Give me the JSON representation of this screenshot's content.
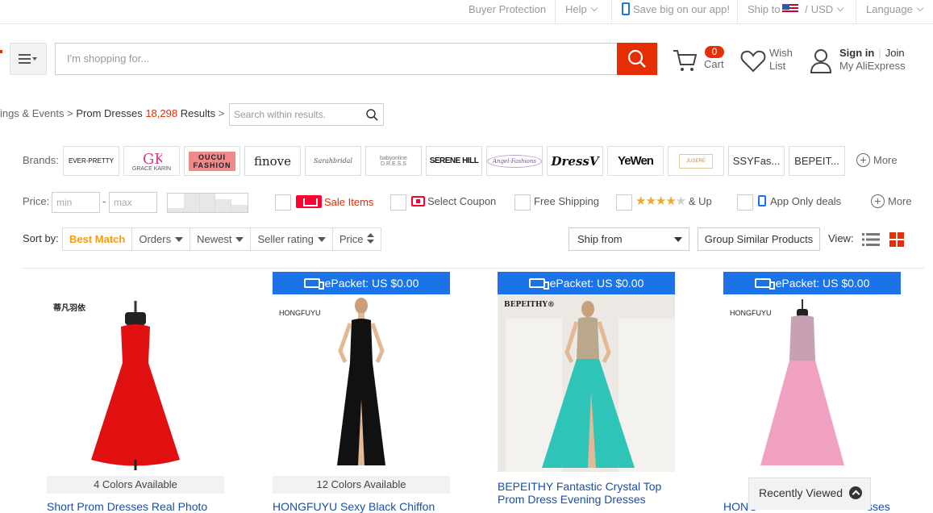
{
  "topbar": {
    "buyer_protection": "Buyer Protection",
    "help": "Help",
    "app": "Save big on our app!",
    "ship_to": "Ship to",
    "currency_sep": "/",
    "currency": "USD",
    "language": "Language"
  },
  "header": {
    "search_placeholder": "I'm shopping for...",
    "cart_count": "0",
    "cart_label": "Cart",
    "wish_line1": "Wish",
    "wish_line2": "List",
    "sign_in": "Sign in",
    "join": "Join",
    "my_account": "My AliExpress"
  },
  "breadcrumb": {
    "parent": "ings & Events",
    "sep": ">",
    "current": "Prom Dresses",
    "count": "18,298",
    "results_label": "Results",
    "sep2": ">",
    "within_placeholder": "Search within results."
  },
  "brands": {
    "label": "Brands:",
    "items": [
      "EVER-PRETTY",
      "GRACE KARIN",
      "OUCUI FASHION",
      "finove",
      "Sarahbridal",
      "babyonline D.R.E.S.S",
      "SERENE HILL",
      "Angel-Fashions",
      "DressV",
      "YeWen",
      "JUSERE",
      "SSYFas...",
      "BEPEIT..."
    ],
    "more": "More"
  },
  "filters": {
    "price_label": "Price:",
    "min_placeholder": "min",
    "max_placeholder": "max",
    "dash": "-",
    "sale_items": "Sale Items",
    "select_coupon": "Select Coupon",
    "free_shipping": "Free Shipping",
    "stars_up": "& Up",
    "app_only": "App Only deals",
    "more": "More"
  },
  "sort": {
    "label": "Sort by:",
    "best_match": "Best Match",
    "orders": "Orders",
    "newest": "Newest",
    "seller_rating": "Seller rating",
    "price": "Price",
    "ship_from": "Ship from",
    "group_similar": "Group Similar Products",
    "view_label": "View:"
  },
  "products": [
    {
      "epacket": "",
      "brand": "蒂凡羽依",
      "colors": "4 Colors Available",
      "title": "Short Prom Dresses Real Photo",
      "dress_color": "#e01010"
    },
    {
      "epacket": "ePacket: US $0.00",
      "brand": "HONGFUYU",
      "colors": "12 Colors Available",
      "title": "HONGFUYU Sexy Black Chiffon",
      "dress_color": "#111111"
    },
    {
      "epacket": "ePacket: US $0.00",
      "brand": "BEPEITHY®",
      "colors": "",
      "title": "BEPEITHY Fantastic Crystal Top Prom Dress Evening Dresses",
      "dress_color": "#2fc4b8"
    },
    {
      "epacket": "ePacket: US $0.00",
      "brand": "HONGFUYU",
      "colors": "",
      "title": "HONG",
      "title_tail": "sses",
      "dress_color": "#f0a0c0"
    }
  ],
  "recently_viewed": "Recently Viewed",
  "colors": {
    "accent": "#e62e04",
    "link": "#1a4fa3",
    "epacket": "#1a73e8",
    "sort_active": "#ff9900"
  }
}
